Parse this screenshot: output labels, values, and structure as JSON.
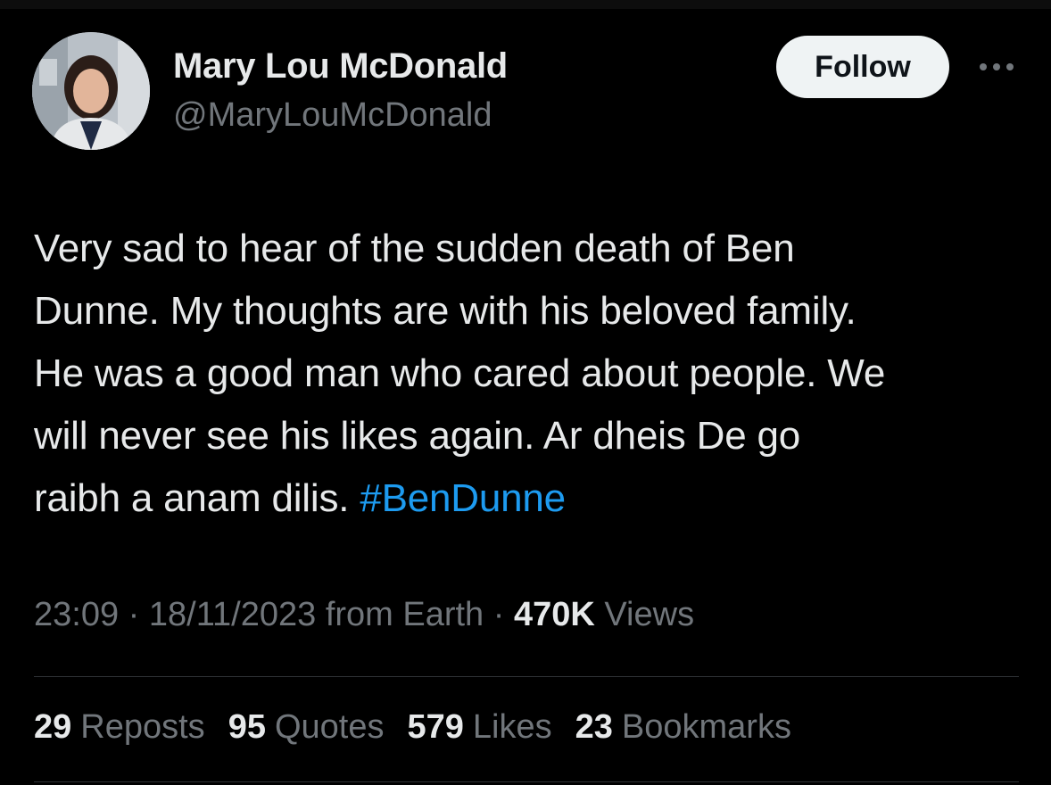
{
  "tweet": {
    "author": {
      "display_name": "Mary Lou McDonald",
      "handle": "@MaryLouMcDonald"
    },
    "follow_label": "Follow",
    "more_icon": "more-horizontal-icon",
    "text_lines": [
      "Very sad to hear of the sudden death of Ben",
      "Dunne. My thoughts are with his beloved family.",
      "He was a good man who cared about people. We",
      "will never see his likes again. Ar dheis De go",
      "raibh a anam dilis."
    ],
    "hashtag": "#BenDunne",
    "meta": {
      "time": "23:09",
      "date": "18/11/2023",
      "source": "from Earth",
      "views_count": "470K",
      "views_label": "Views",
      "separator": "·"
    },
    "stats": {
      "reposts": {
        "count": "29",
        "label": "Reposts"
      },
      "quotes": {
        "count": "95",
        "label": "Quotes"
      },
      "likes": {
        "count": "579",
        "label": "Likes"
      },
      "bookmarks": {
        "count": "23",
        "label": "Bookmarks"
      }
    }
  },
  "colors": {
    "background": "#000000",
    "text": "#e7e9ea",
    "secondary": "#71767b",
    "link": "#1d9bf0",
    "divider": "#2f3336",
    "button_bg": "#eff3f4"
  }
}
